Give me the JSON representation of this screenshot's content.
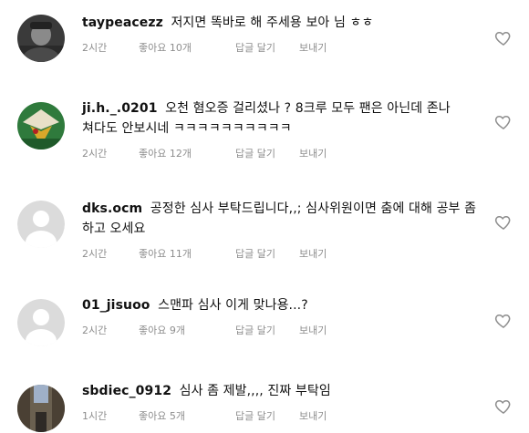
{
  "comments": [
    {
      "username": "taypeacezz",
      "text": "저지면 똑바로 해 주세용 보아 님 ㅎㅎ",
      "time": "2시간",
      "likes": "좋아요 10개",
      "reply": "답글 달기",
      "send": "보내기",
      "avatar_icon": "profile-photo",
      "heart_icon": "heart-outline-icon"
    },
    {
      "username": "ji.h._.0201",
      "text": "오천 혐오증 걸리셨나 ? 8크루 모두 팬은 아닌데 존나 쳐다도 안보시네 ㅋㅋㅋㅋㅋㅋㅋㅋㅋㅋ",
      "time": "2시간",
      "likes": "좋아요 12개",
      "reply": "답글 달기",
      "send": "보내기",
      "avatar_icon": "profile-photo",
      "heart_icon": "heart-outline-icon"
    },
    {
      "username": "dks.ocm",
      "text": "공정한 심사 부탁드립니다,,; 심사위원이면 춤에 대해 공부 좀 하고 오세요",
      "time": "2시간",
      "likes": "좋아요 11개",
      "reply": "답글 달기",
      "send": "보내기",
      "avatar_icon": "default-avatar-icon",
      "heart_icon": "heart-outline-icon"
    },
    {
      "username": "01_jisuoo",
      "text": "스맨파 심사 이게 맞나용...?",
      "time": "2시간",
      "likes": "좋아요 9개",
      "reply": "답글 달기",
      "send": "보내기",
      "avatar_icon": "default-avatar-icon",
      "heart_icon": "heart-outline-icon"
    },
    {
      "username": "sbdiec_0912",
      "text": "심사 좀 제발,,,, 진짜 부탁임",
      "time": "1시간",
      "likes": "좋아요 5개",
      "reply": "답글 달기",
      "send": "보내기",
      "avatar_icon": "profile-photo",
      "heart_icon": "heart-outline-icon"
    }
  ],
  "colors": {
    "text": "#111111",
    "meta": "#8e8e8e",
    "default_avatar_bg": "#dbdbdb",
    "default_avatar_fg": "#ffffff"
  }
}
